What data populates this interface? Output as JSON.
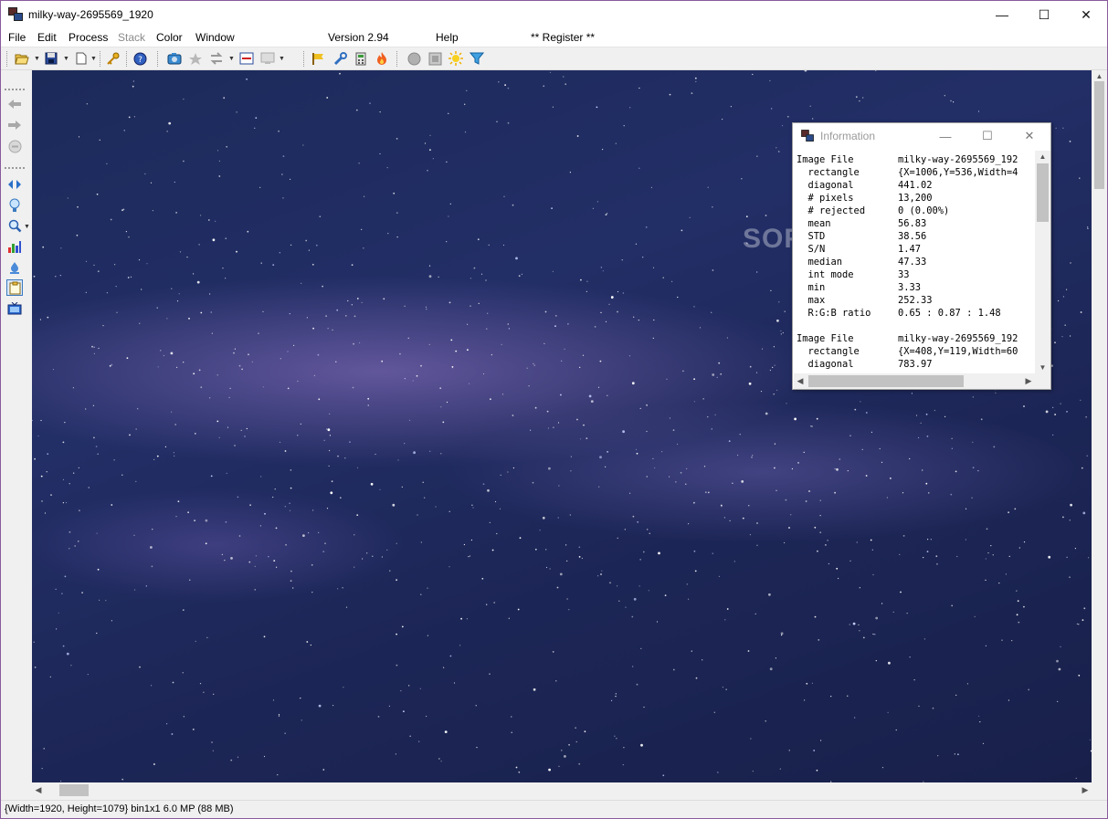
{
  "window": {
    "title": "milky-way-2695569_1920"
  },
  "window_controls": {
    "minimize": "—",
    "maximize": "☐",
    "close": "✕"
  },
  "menu": [
    {
      "label": "File"
    },
    {
      "label": "Edit"
    },
    {
      "label": "Process"
    },
    {
      "label": "Stack"
    },
    {
      "label": "Color"
    },
    {
      "label": "Window"
    },
    {
      "label": "Version 2.94"
    },
    {
      "label": "Help"
    },
    {
      "label": "** Register **"
    }
  ],
  "toolbar_icons": [
    "open-folder-icon",
    "save-disk-icon",
    "new-document-icon",
    "key-icon",
    "help-icon",
    "camera-icon",
    "star-icon",
    "swap-icon",
    "subtract-icon",
    "monitor-icon",
    "flag-icon",
    "wrench-icon",
    "calculator-icon",
    "flame-icon",
    "circle-icon",
    "square-icon",
    "sun-icon",
    "filter-icon"
  ],
  "left_toolbar_icons": [
    "back-arrow-icon",
    "forward-arrow-icon",
    "stop-icon",
    "double-arrow-icon",
    "bulb-icon",
    "zoom-icon",
    "histogram-icon",
    "drop-icon",
    "clipboard-icon",
    "tv-icon"
  ],
  "info_window": {
    "title": "Information",
    "rows": [
      {
        "key": "Image File",
        "value": "milky-way-2695569_192"
      },
      {
        "key": "  rectangle",
        "value": "{X=1006,Y=536,Width=4"
      },
      {
        "key": "  diagonal",
        "value": "441.02"
      },
      {
        "key": "  # pixels",
        "value": "13,200"
      },
      {
        "key": "  # rejected",
        "value": "0 (0.00%)"
      },
      {
        "key": "  mean",
        "value": "56.83"
      },
      {
        "key": "  STD",
        "value": "38.56"
      },
      {
        "key": "  S/N",
        "value": "1.47"
      },
      {
        "key": "  median",
        "value": "47.33"
      },
      {
        "key": "  int mode",
        "value": "33"
      },
      {
        "key": "  min",
        "value": "3.33"
      },
      {
        "key": "  max",
        "value": "252.33"
      },
      {
        "key": "  R:G:B ratio",
        "value": "0.65 : 0.87 : 1.48"
      },
      {
        "key": "",
        "value": ""
      },
      {
        "key": "Image File",
        "value": "milky-way-2695569_192"
      },
      {
        "key": "  rectangle",
        "value": "{X=408,Y=119,Width=60"
      },
      {
        "key": "  diagonal",
        "value": "783.97"
      }
    ]
  },
  "watermark": "SOFTPEDIA",
  "status": {
    "text": "{Width=1920, Height=1079} bin1x1  6.0 MP (88 MB)"
  }
}
